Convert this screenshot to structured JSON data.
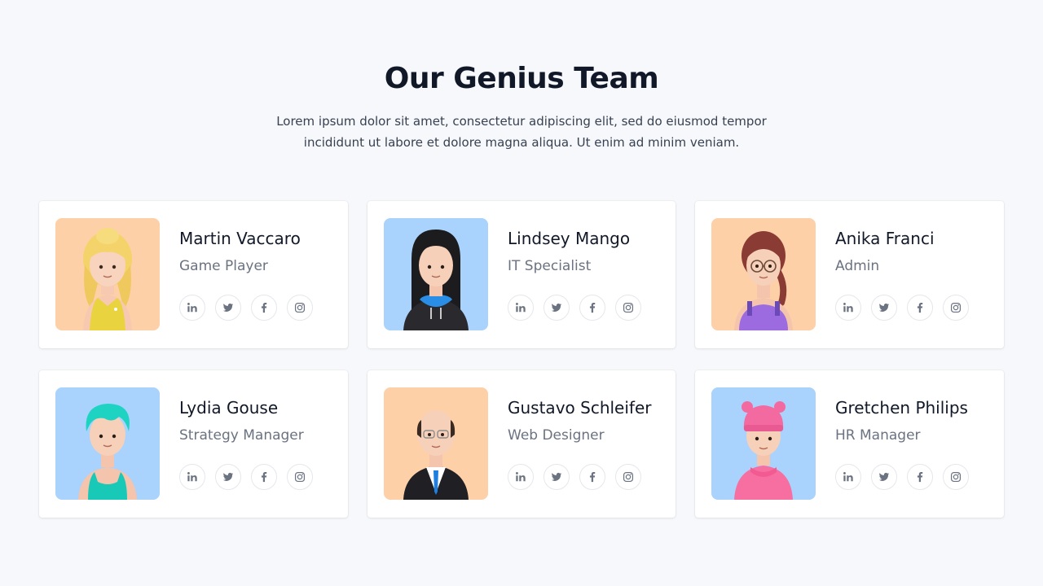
{
  "header": {
    "title": "Our Genius Team",
    "subtitle": "Lorem ipsum dolor sit amet, consectetur adipiscing elit, sed do eiusmod tempor incididunt ut labore et dolore magna aliqua. Ut enim ad minim veniam."
  },
  "team": [
    {
      "name": "Martin Vaccaro",
      "role": "Game Player",
      "bg": "#fdd0a8"
    },
    {
      "name": "Lindsey Mango",
      "role": "IT Specialist",
      "bg": "#a9d2fd"
    },
    {
      "name": "Anika Franci",
      "role": "Admin",
      "bg": "#fdd0a8"
    },
    {
      "name": "Lydia Gouse",
      "role": "Strategy Manager",
      "bg": "#a9d2fd"
    },
    {
      "name": "Gustavo Schleifer",
      "role": "Web Designer",
      "bg": "#fdd0a8"
    },
    {
      "name": "Gretchen Philips",
      "role": "HR Manager",
      "bg": "#a9d2fd"
    }
  ],
  "social_icons": [
    "linkedin-icon",
    "twitter-icon",
    "facebook-icon",
    "instagram-icon"
  ],
  "colors": {
    "orange_bg": "#fdd0a8",
    "blue_bg": "#a9d2fd",
    "page_bg": "#f7f8fb"
  }
}
